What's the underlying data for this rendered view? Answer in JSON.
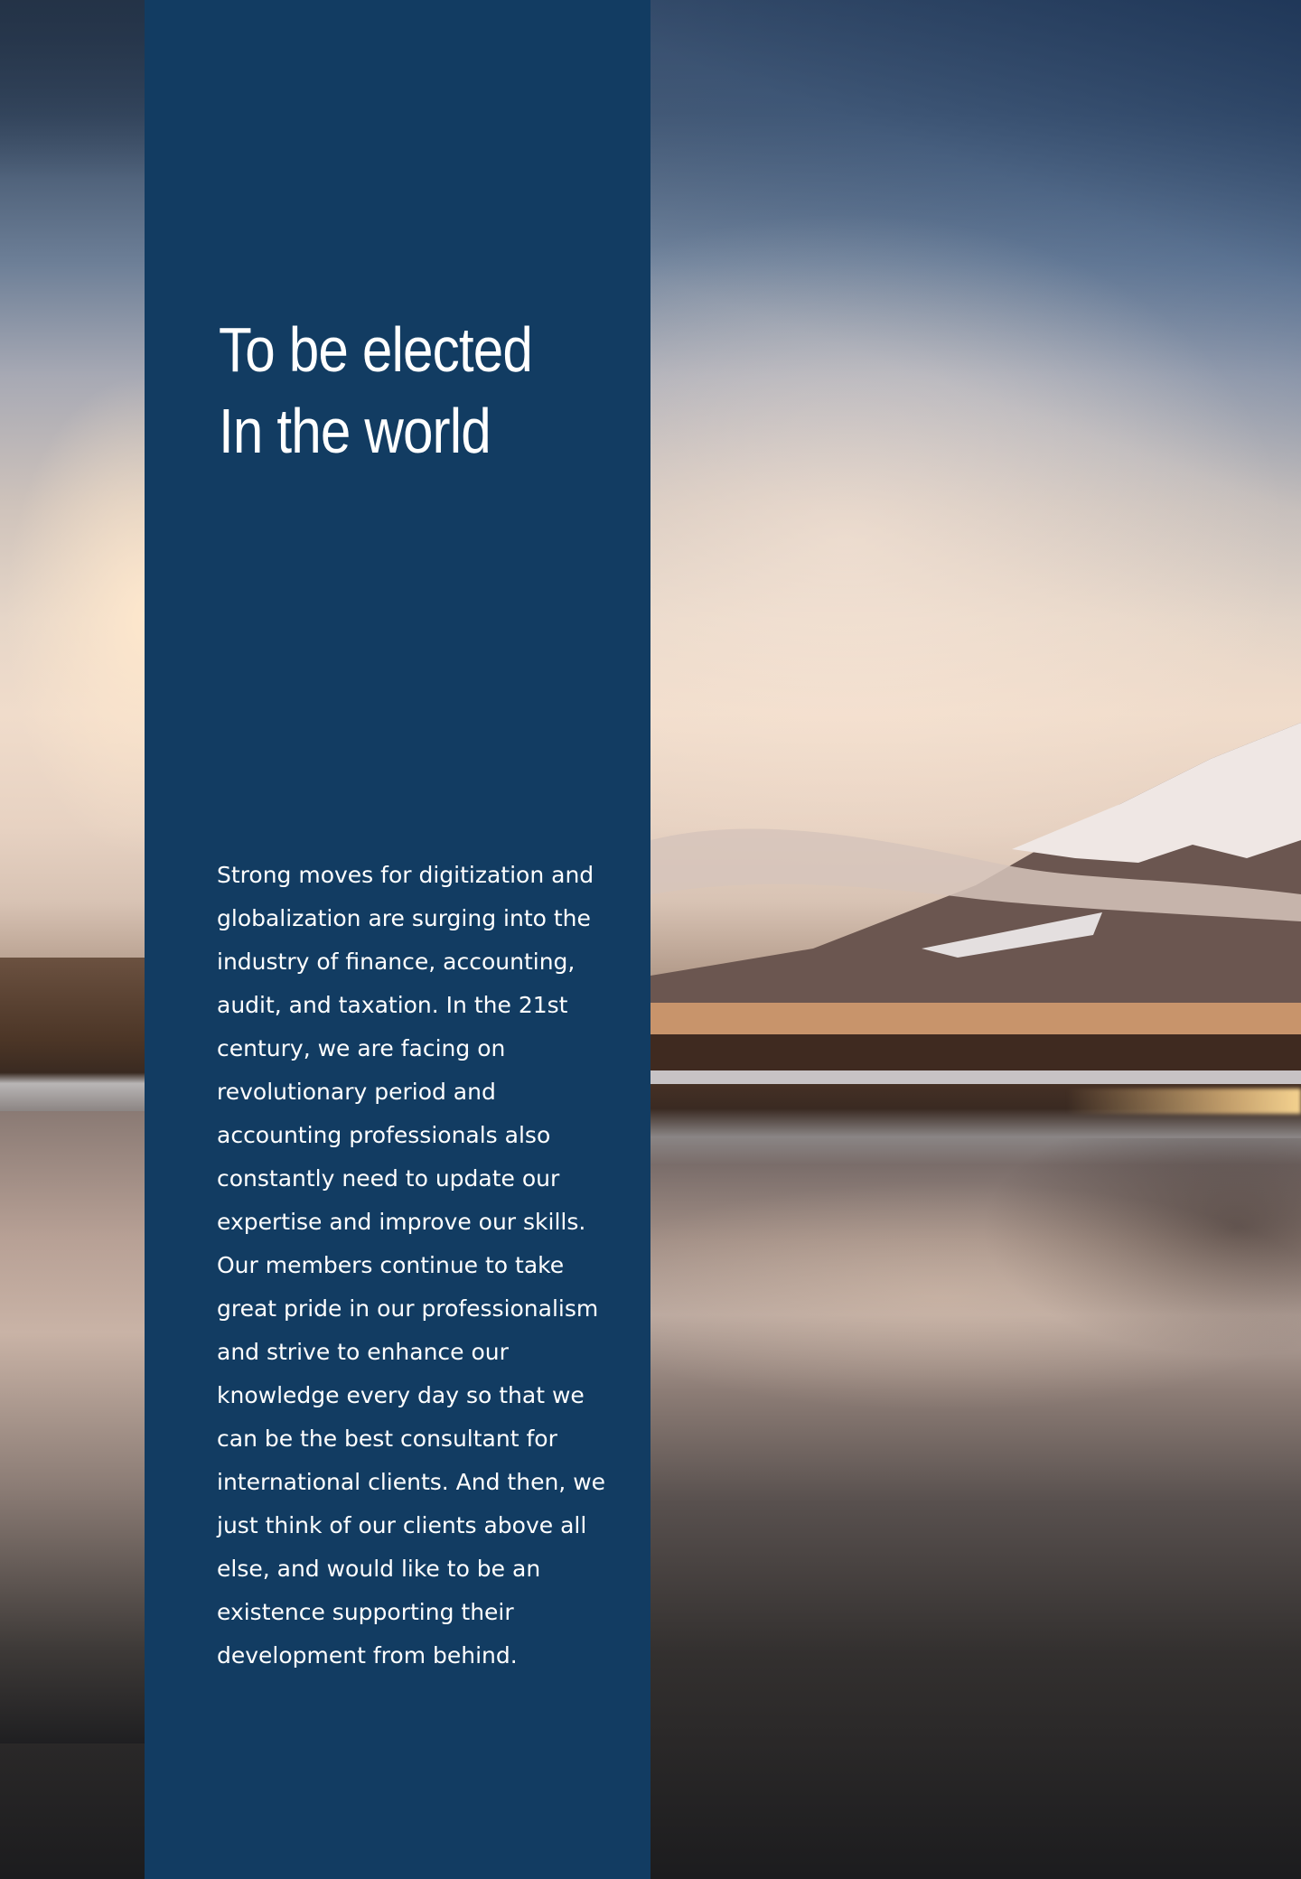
{
  "hero": {
    "title_line_1": "To be elected",
    "title_line_2": "In the world"
  },
  "intro": {
    "paragraph_1": "Strong moves for digitization and globalization are surging into the industry of finance, accounting, audit, and taxation. In the 21st century, we are facing on revolutionary period and accounting professionals also constantly need to update our expertise and improve our skills.",
    "paragraph_2": "Our members continue to take great pride in our professionalism and strive to enhance our knowledge every day so that we can be the best consultant for international clients. And then, we just think of our clients above all else, and would like to be an existence supporting their development from behind."
  },
  "colors": {
    "panel": "#123c62",
    "text": "#ffffff"
  }
}
